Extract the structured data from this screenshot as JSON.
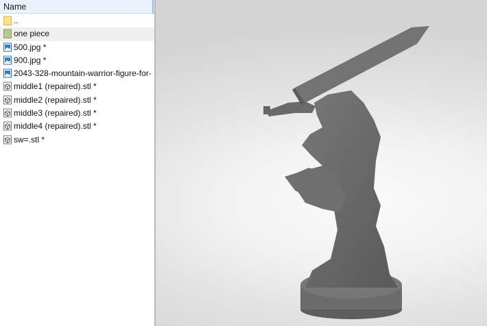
{
  "file_list": {
    "column_header": "Name",
    "items": [
      {
        "label": "..",
        "icon": "folder-icon"
      },
      {
        "label": "one piece",
        "icon": "folder-icon"
      },
      {
        "label": "500.jpg *",
        "icon": "image-file-icon"
      },
      {
        "label": "900.jpg *",
        "icon": "image-file-icon"
      },
      {
        "label": "2043-328-mountain-warrior-figure-for-",
        "icon": "image-file-icon"
      },
      {
        "label": "middle1 (repaired).stl *",
        "icon": "stl-file-icon"
      },
      {
        "label": "middle2 (repaired).stl *",
        "icon": "stl-file-icon"
      },
      {
        "label": "middle3 (repaired).stl *",
        "icon": "stl-file-icon"
      },
      {
        "label": "middle4 (repaired).stl *",
        "icon": "stl-file-icon"
      },
      {
        "label": "sw=.stl *",
        "icon": "stl-file-icon"
      }
    ]
  },
  "viewport": {
    "model_color": "#6b6b6b",
    "background_color": "#ececec"
  }
}
